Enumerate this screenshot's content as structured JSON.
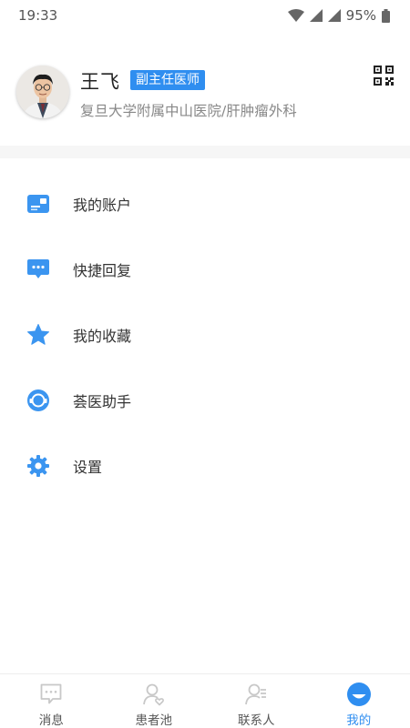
{
  "status_bar": {
    "time": "19:33",
    "battery": "95%"
  },
  "profile": {
    "name": "王飞",
    "title": "副主任医师",
    "organization": "复旦大学附属中山医院/肝肿瘤外科"
  },
  "menu": {
    "items": [
      {
        "label": "我的账户",
        "icon": "account-card-icon"
      },
      {
        "label": "快捷回复",
        "icon": "chat-bubble-icon"
      },
      {
        "label": "我的收藏",
        "icon": "star-icon"
      },
      {
        "label": "荟医助手",
        "icon": "assistant-icon"
      },
      {
        "label": "设置",
        "icon": "gear-icon"
      }
    ]
  },
  "tabs": [
    {
      "label": "消息",
      "active": false
    },
    {
      "label": "患者池",
      "active": false
    },
    {
      "label": "联系人",
      "active": false
    },
    {
      "label": "我的",
      "active": true
    }
  ],
  "colors": {
    "accent": "#2f8ef0",
    "inactive_icon": "#c8c8c8"
  }
}
